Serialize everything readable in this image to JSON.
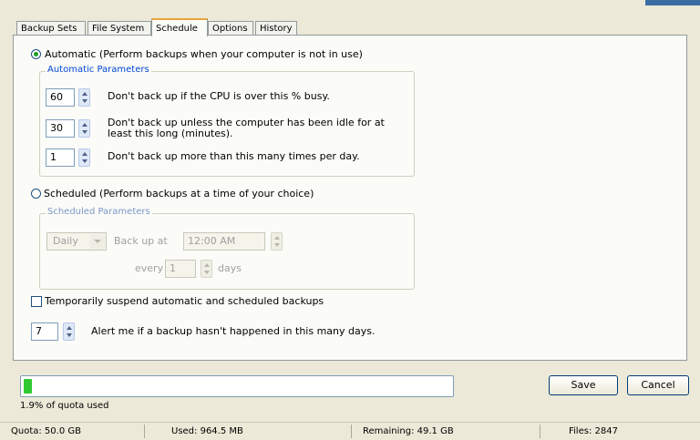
{
  "tabs": [
    "Backup Sets",
    "File System",
    "Schedule",
    "Options",
    "History"
  ],
  "active_tab": "Schedule",
  "automatic": {
    "label": "Automatic (Perform backups when your computer is not in use)",
    "selected": true,
    "group_title": "Automatic Parameters",
    "params": [
      {
        "value": "60",
        "text": "Don't back up if the CPU is over this % busy."
      },
      {
        "value": "30",
        "text": "Don't back up unless the computer has been idle for at",
        "text2": "least this long (minutes)."
      },
      {
        "value": "1",
        "text": "Don't back up more than this many times per day."
      }
    ]
  },
  "scheduled": {
    "label": "Scheduled (Perform backups at a time of your choice)",
    "selected": false,
    "group_title": "Scheduled Parameters",
    "frequency": "Daily",
    "backup_at_label": "Back up at",
    "time": "12:00 AM",
    "every_label": "every",
    "every_value": "1",
    "days_label": "days"
  },
  "suspend": {
    "label": "Temporarily suspend automatic and scheduled backups",
    "checked": false
  },
  "alert": {
    "value": "7",
    "label": "Alert me if a backup hasn't happened in this many days."
  },
  "quota": {
    "percent": 1.9,
    "label": "1.9% of quota used"
  },
  "buttons": {
    "save": "Save",
    "cancel": "Cancel"
  },
  "status": {
    "quota": "Quota: 50.0 GB",
    "used": "Used: 964.5 MB",
    "remaining": "Remaining: 49.1 GB",
    "files": "Files: 2847"
  },
  "colors": {
    "progress_fill": "#30c832",
    "active_tab_accent": "#e7a53b",
    "group_title": "#0046d5"
  }
}
